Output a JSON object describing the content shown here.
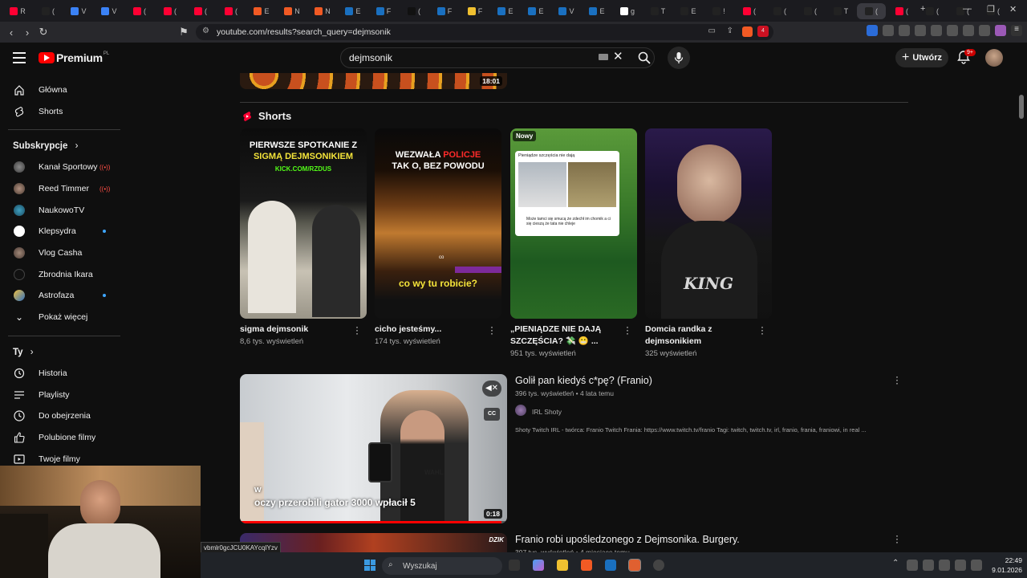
{
  "browser": {
    "tabs": [
      "R",
      "(",
      "V",
      "V",
      "(",
      "(",
      "(",
      "(",
      "E",
      "N",
      "N",
      "E",
      "F",
      "(",
      "F",
      "F",
      "E",
      "E",
      "V",
      "E",
      "g",
      "T",
      "E",
      "!",
      "(",
      "(",
      "(",
      "T",
      "(",
      "(",
      "(",
      "(",
      "("
    ],
    "url": "youtube.com/results?search_query=dejmsonik",
    "brave_badge": "4"
  },
  "header": {
    "logo_text": "Premium",
    "logo_country": "PL",
    "search_value": "dejmsonik",
    "create_label": "Utwórz",
    "notification_count": "9+"
  },
  "sidebar": {
    "top_items": [
      {
        "label": "Główna",
        "icon": "home-icon"
      },
      {
        "label": "Shorts",
        "icon": "shorts-icon"
      }
    ],
    "subscriptions_heading": "Subskrypcje",
    "subscriptions": [
      {
        "label": "Kanał Sportowy",
        "status": "live"
      },
      {
        "label": "Reed Timmer",
        "status": "live"
      },
      {
        "label": "NaukowoTV",
        "status": ""
      },
      {
        "label": "Klepsydra",
        "status": "new"
      },
      {
        "label": "Vlog Casha",
        "status": ""
      },
      {
        "label": "Zbrodnia Ikara",
        "status": ""
      },
      {
        "label": "Astrofaza",
        "status": "new"
      }
    ],
    "show_more": "Pokaż więcej",
    "you_heading": "Ty",
    "you_items": [
      {
        "label": "Historia",
        "icon": "history-icon"
      },
      {
        "label": "Playlisty",
        "icon": "playlists-icon"
      },
      {
        "label": "Do obejrzenia",
        "icon": "watch-later-icon"
      },
      {
        "label": "Polubione filmy",
        "icon": "liked-icon"
      },
      {
        "label": "Twoje filmy",
        "icon": "your-videos-icon"
      }
    ]
  },
  "results": {
    "top_video_duration": "18:01",
    "shorts_heading": "Shorts",
    "shorts": [
      {
        "title": "sigma dejmsonik",
        "views": "8,6 tys. wyświetleń",
        "overlay_top": "PIERWSZE SPOTKANIE Z",
        "overlay_highlight": "SIGMĄ DEJMSONIKIEM",
        "overlay_small": "KICK.COM/RZDUS"
      },
      {
        "title": "cicho jesteśmy...",
        "views": "174 tys. wyświetleń",
        "overlay_top": "WEZWAŁA",
        "overlay_highlight": "POLICJE",
        "overlay_top2": "TAK O, BEZ POWODU",
        "overlay_bottom": "co wy tu robicie?",
        "overlay_co": "co"
      },
      {
        "title": "„PIENIĄDZE NIE DAJĄ SZCZĘŚCIA? 💸 😬 ...",
        "views": "951 tys. wyświetleń",
        "badge": "Nowy",
        "card_caption": "Pieniądze szczęścia nie dają",
        "card_comment": "Może tamci się smucą że zdechł im chomik a ci się cieszą że tata nie chleje"
      },
      {
        "title": "Domcia randka z dejmsonikiem",
        "views": "325 wyświetleń",
        "overlay_bottom": "KING"
      }
    ],
    "videos": [
      {
        "title": "Golił pan kiedyś c*pę? (Franio)",
        "views": "396 tys. wyświetleń",
        "age": "4 lata temu",
        "channel": "IRL Shoty",
        "description": "Shoty Twitch IRL - twórca: Franio Twitch Frania: https://www.twitch.tv/franio Tagi: twitch, twitch.tv, irl, franio, frania, franiowi, in real ...",
        "duration": "0:18",
        "caption_small": "w",
        "caption": "oczy przerobili gator 3000 wpłacił 5",
        "cc_label": "CC",
        "watermark": "WAHL"
      },
      {
        "title": "Franio robi upośledzonego z Dejmsonika. Burgery.",
        "views": "397 tys. wyświetleń",
        "age": "4 miesiące temu",
        "watermark": "DZIK"
      }
    ]
  },
  "status_url": "vbmlr0gcJCU0KAYcqIYzv",
  "taskbar": {
    "search_placeholder": "Wyszukaj",
    "time": "22:49",
    "date": "9.01.2026"
  },
  "colors": {
    "yt_red": "#ff0000",
    "bg": "#0f0f0f",
    "meta_gray": "#aaaaaa",
    "new_dot": "#3ea6ff"
  }
}
